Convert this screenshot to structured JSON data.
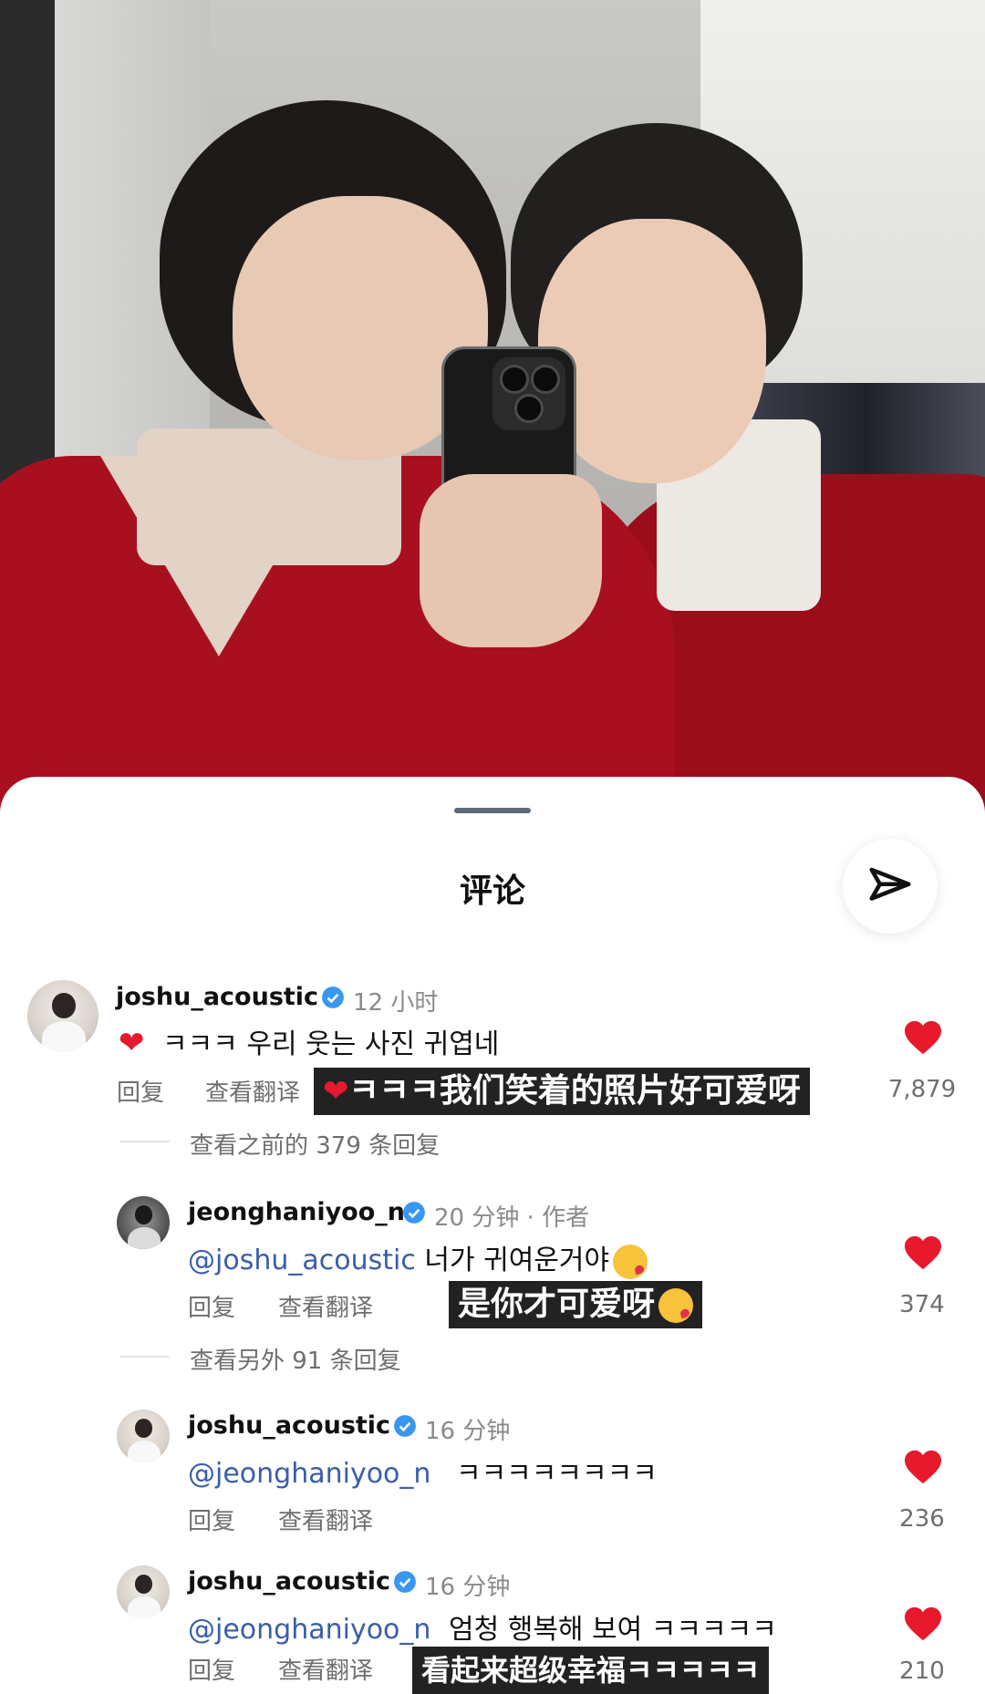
{
  "sheet": {
    "title": "评论"
  },
  "comments": [
    {
      "user": "joshu_acoustic",
      "time": "12 小时",
      "text": "ㅋㅋㅋ 우리 웃는 사진 귀엽네",
      "reply_label": "回复",
      "translate_label": "查看翻译",
      "translation": "ㅋㅋㅋ我们笑着的照片好可爱呀",
      "likes": "7,879",
      "more_replies": "查看之前的 379 条回复"
    },
    {
      "user": "jeonghaniyoo_n",
      "time": "20 分钟 · 作者",
      "mention": "@joshu_acoustic",
      "text": "너가 귀여운거야",
      "reply_label": "回复",
      "translate_label": "查看翻译",
      "translation": "是你才可爱呀",
      "likes": "374",
      "more_replies": "查看另外 91 条回复"
    },
    {
      "user": "joshu_acoustic",
      "time": "16 分钟",
      "mention": "@jeonghaniyoo_n",
      "text": "ㅋㅋㅋㅋㅋㅋㅋㅋ",
      "reply_label": "回复",
      "translate_label": "查看翻译",
      "likes": "236"
    },
    {
      "user": "joshu_acoustic",
      "time": "16 分钟",
      "mention": "@jeonghaniyoo_n",
      "text": "엄청 행복해 보여 ㅋㅋㅋㅋㅋ",
      "reply_label": "回复",
      "translate_label": "查看翻译",
      "translation": "看起来超级幸福ㅋㅋㅋㅋㅋ",
      "likes": "210"
    }
  ],
  "icons": {
    "share": "paper-plane-icon",
    "verified": "verified-badge-icon",
    "like": "heart-icon"
  },
  "colors": {
    "like": "#e8192c",
    "verified": "#3897f0",
    "mention": "#3a5ea8"
  }
}
